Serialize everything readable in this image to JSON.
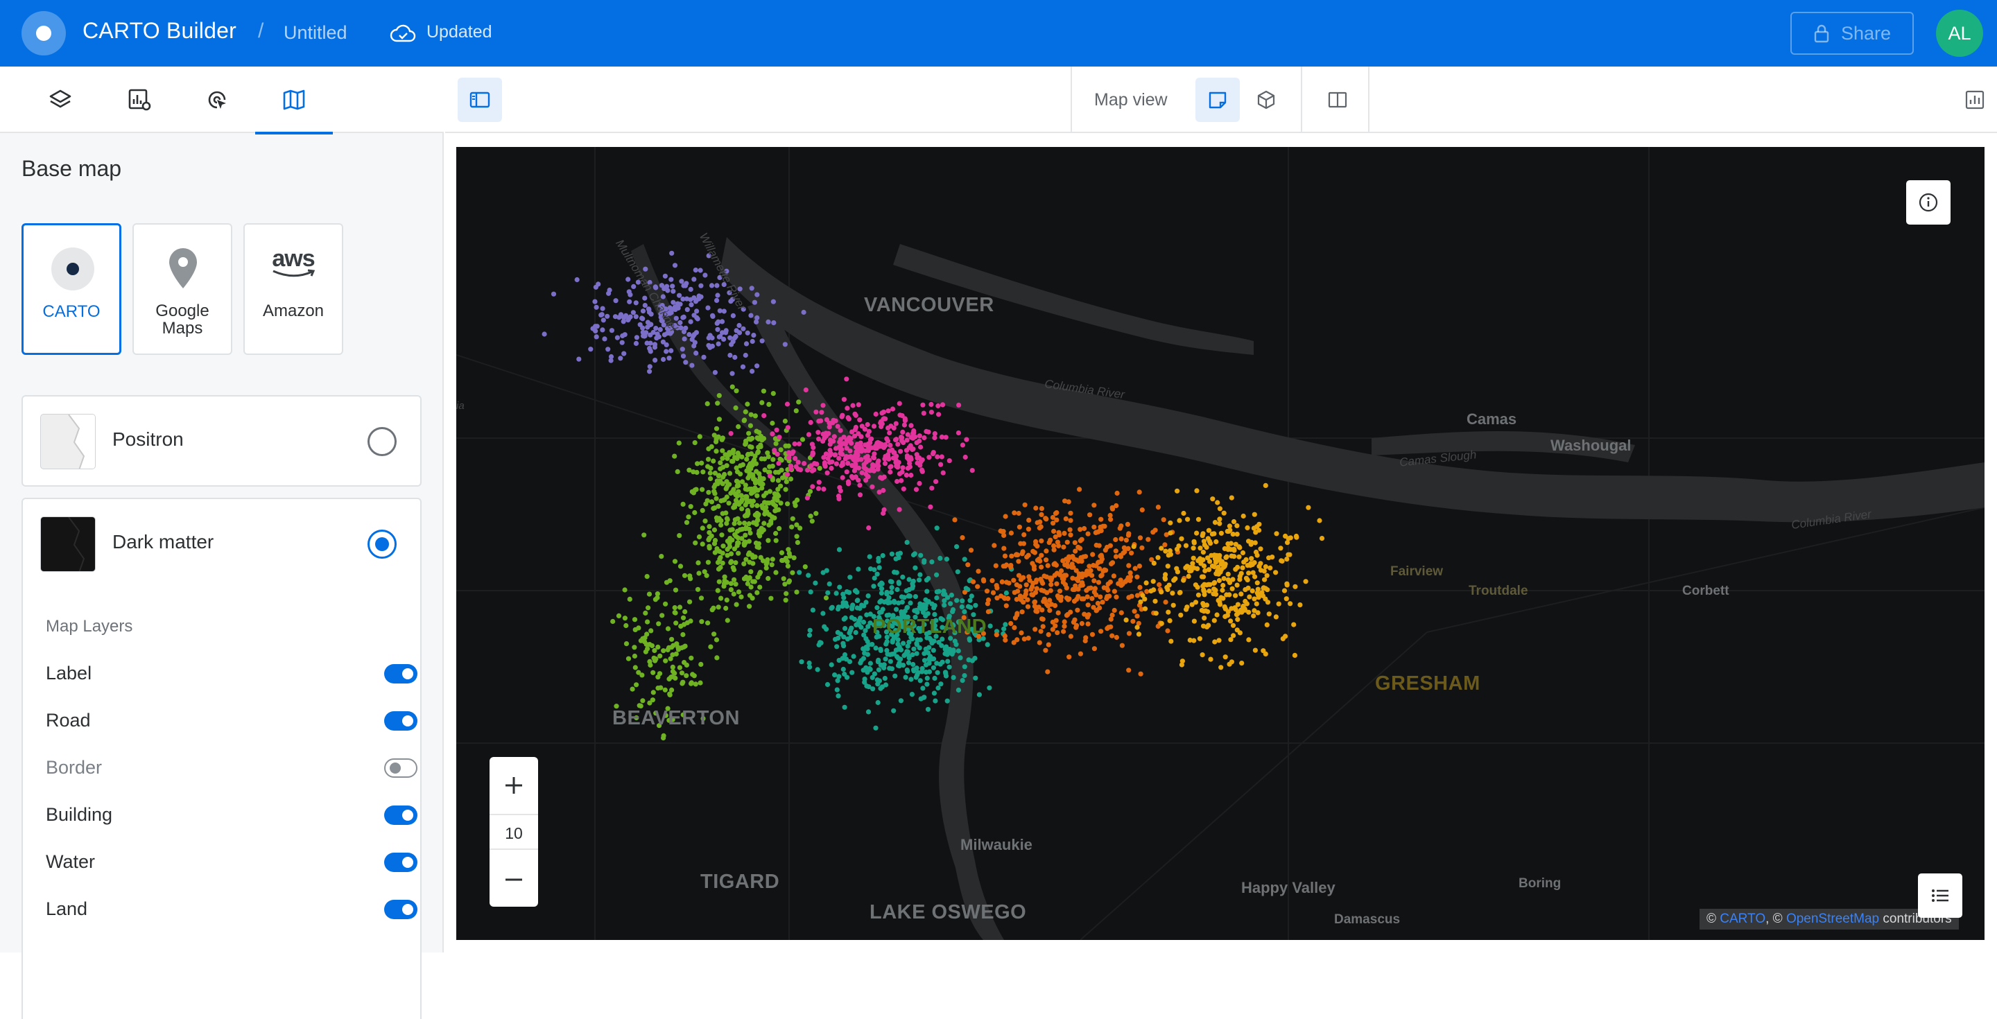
{
  "header": {
    "app_title": "CARTO Builder",
    "breadcrumb_sep": "/",
    "map_title": "Untitled",
    "save_status": "Updated",
    "share_label": "Share",
    "avatar_initials": "AL",
    "colors": {
      "brand": "#036fe2",
      "avatar": "#1ab07f"
    }
  },
  "left_panel": {
    "tabs": [
      {
        "name": "layers",
        "icon": "layers-icon"
      },
      {
        "name": "widgets",
        "icon": "widgets-icon"
      },
      {
        "name": "interactions",
        "icon": "interactions-icon"
      },
      {
        "name": "basemap",
        "icon": "map-icon",
        "active": true
      }
    ],
    "section_title": "Base map",
    "providers": [
      {
        "label": "CARTO",
        "icon": "carto-logo-icon",
        "selected": true
      },
      {
        "label_line1": "Google",
        "label_line2": "Maps",
        "icon": "map-pin-icon",
        "selected": false
      },
      {
        "label": "Amazon",
        "logo_text": "aws",
        "icon": "aws-logo-icon",
        "selected": false
      }
    ],
    "styles": [
      {
        "label": "Positron",
        "selected": false
      },
      {
        "label": "Dark matter",
        "selected": true
      }
    ],
    "map_layers": {
      "title": "Map Layers",
      "items": [
        {
          "label": "Label",
          "enabled": true
        },
        {
          "label": "Road",
          "enabled": true
        },
        {
          "label": "Border",
          "enabled": false
        },
        {
          "label": "Building",
          "enabled": true
        },
        {
          "label": "Water",
          "enabled": true
        },
        {
          "label": "Land",
          "enabled": true
        }
      ]
    }
  },
  "toolbar": {
    "map_view_label": "Map view",
    "buttons": [
      "panel-toggle-icon",
      "2d-view-icon",
      "3d-view-icon",
      "split-view-icon",
      "chart-icon"
    ]
  },
  "map": {
    "zoom_level": "10",
    "labels": {
      "vancouver": "VANCOUVER",
      "beaverton": "BEAVERTON",
      "tigard": "TIGARD",
      "lake_oswego": "LAKE OSWEGO",
      "milwaukie": "Milwaukie",
      "happy_valley": "Happy Valley",
      "damascus": "Damascus",
      "boring": "Boring",
      "camas": "Camas",
      "washougal": "Washougal",
      "corbett": "Corbett",
      "fairview": "Fairview",
      "troutdale": "Troutdale",
      "gresham": "GRESHAM",
      "portland": "PORTLAND",
      "columbia_river_1": "Columbia River",
      "columbia_river_2": "Columbia River",
      "camas_slough": "Camas Slough",
      "willamette_river": "Willamette River",
      "multnomah_channel": "Multnomah Channel",
      "edge_label": "ia"
    },
    "attribution": {
      "prefix": "©",
      "carto": "CARTO",
      "sep": ", ©",
      "osm": "OpenStreetMap",
      "suffix": "contributors"
    },
    "point_colors": {
      "cluster_purple": "#7b6fc9",
      "cluster_green": "#6fb323",
      "cluster_pink": "#e2349c",
      "cluster_teal": "#17a38a",
      "cluster_orange": "#e0670e",
      "cluster_yellow": "#e8a50d"
    }
  }
}
